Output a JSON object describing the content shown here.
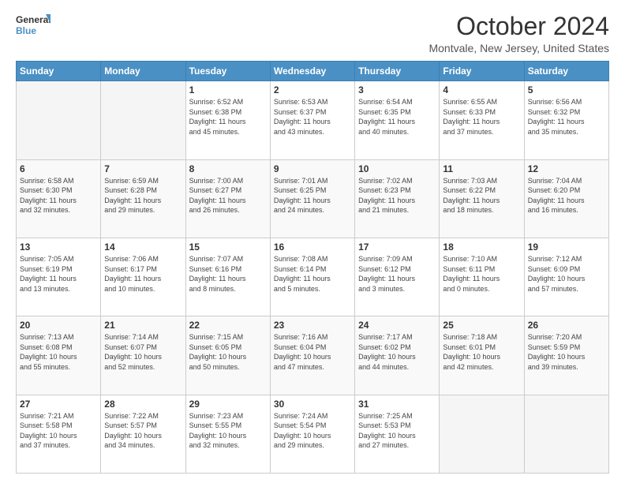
{
  "logo": {
    "line1": "General",
    "line2": "Blue",
    "icon_color": "#4a90c4"
  },
  "header": {
    "title": "October 2024",
    "subtitle": "Montvale, New Jersey, United States"
  },
  "days_of_week": [
    "Sunday",
    "Monday",
    "Tuesday",
    "Wednesday",
    "Thursday",
    "Friday",
    "Saturday"
  ],
  "weeks": [
    [
      {
        "day": "",
        "info": ""
      },
      {
        "day": "",
        "info": ""
      },
      {
        "day": "1",
        "info": "Sunrise: 6:52 AM\nSunset: 6:38 PM\nDaylight: 11 hours\nand 45 minutes."
      },
      {
        "day": "2",
        "info": "Sunrise: 6:53 AM\nSunset: 6:37 PM\nDaylight: 11 hours\nand 43 minutes."
      },
      {
        "day": "3",
        "info": "Sunrise: 6:54 AM\nSunset: 6:35 PM\nDaylight: 11 hours\nand 40 minutes."
      },
      {
        "day": "4",
        "info": "Sunrise: 6:55 AM\nSunset: 6:33 PM\nDaylight: 11 hours\nand 37 minutes."
      },
      {
        "day": "5",
        "info": "Sunrise: 6:56 AM\nSunset: 6:32 PM\nDaylight: 11 hours\nand 35 minutes."
      }
    ],
    [
      {
        "day": "6",
        "info": "Sunrise: 6:58 AM\nSunset: 6:30 PM\nDaylight: 11 hours\nand 32 minutes."
      },
      {
        "day": "7",
        "info": "Sunrise: 6:59 AM\nSunset: 6:28 PM\nDaylight: 11 hours\nand 29 minutes."
      },
      {
        "day": "8",
        "info": "Sunrise: 7:00 AM\nSunset: 6:27 PM\nDaylight: 11 hours\nand 26 minutes."
      },
      {
        "day": "9",
        "info": "Sunrise: 7:01 AM\nSunset: 6:25 PM\nDaylight: 11 hours\nand 24 minutes."
      },
      {
        "day": "10",
        "info": "Sunrise: 7:02 AM\nSunset: 6:23 PM\nDaylight: 11 hours\nand 21 minutes."
      },
      {
        "day": "11",
        "info": "Sunrise: 7:03 AM\nSunset: 6:22 PM\nDaylight: 11 hours\nand 18 minutes."
      },
      {
        "day": "12",
        "info": "Sunrise: 7:04 AM\nSunset: 6:20 PM\nDaylight: 11 hours\nand 16 minutes."
      }
    ],
    [
      {
        "day": "13",
        "info": "Sunrise: 7:05 AM\nSunset: 6:19 PM\nDaylight: 11 hours\nand 13 minutes."
      },
      {
        "day": "14",
        "info": "Sunrise: 7:06 AM\nSunset: 6:17 PM\nDaylight: 11 hours\nand 10 minutes."
      },
      {
        "day": "15",
        "info": "Sunrise: 7:07 AM\nSunset: 6:16 PM\nDaylight: 11 hours\nand 8 minutes."
      },
      {
        "day": "16",
        "info": "Sunrise: 7:08 AM\nSunset: 6:14 PM\nDaylight: 11 hours\nand 5 minutes."
      },
      {
        "day": "17",
        "info": "Sunrise: 7:09 AM\nSunset: 6:12 PM\nDaylight: 11 hours\nand 3 minutes."
      },
      {
        "day": "18",
        "info": "Sunrise: 7:10 AM\nSunset: 6:11 PM\nDaylight: 11 hours\nand 0 minutes."
      },
      {
        "day": "19",
        "info": "Sunrise: 7:12 AM\nSunset: 6:09 PM\nDaylight: 10 hours\nand 57 minutes."
      }
    ],
    [
      {
        "day": "20",
        "info": "Sunrise: 7:13 AM\nSunset: 6:08 PM\nDaylight: 10 hours\nand 55 minutes."
      },
      {
        "day": "21",
        "info": "Sunrise: 7:14 AM\nSunset: 6:07 PM\nDaylight: 10 hours\nand 52 minutes."
      },
      {
        "day": "22",
        "info": "Sunrise: 7:15 AM\nSunset: 6:05 PM\nDaylight: 10 hours\nand 50 minutes."
      },
      {
        "day": "23",
        "info": "Sunrise: 7:16 AM\nSunset: 6:04 PM\nDaylight: 10 hours\nand 47 minutes."
      },
      {
        "day": "24",
        "info": "Sunrise: 7:17 AM\nSunset: 6:02 PM\nDaylight: 10 hours\nand 44 minutes."
      },
      {
        "day": "25",
        "info": "Sunrise: 7:18 AM\nSunset: 6:01 PM\nDaylight: 10 hours\nand 42 minutes."
      },
      {
        "day": "26",
        "info": "Sunrise: 7:20 AM\nSunset: 5:59 PM\nDaylight: 10 hours\nand 39 minutes."
      }
    ],
    [
      {
        "day": "27",
        "info": "Sunrise: 7:21 AM\nSunset: 5:58 PM\nDaylight: 10 hours\nand 37 minutes."
      },
      {
        "day": "28",
        "info": "Sunrise: 7:22 AM\nSunset: 5:57 PM\nDaylight: 10 hours\nand 34 minutes."
      },
      {
        "day": "29",
        "info": "Sunrise: 7:23 AM\nSunset: 5:55 PM\nDaylight: 10 hours\nand 32 minutes."
      },
      {
        "day": "30",
        "info": "Sunrise: 7:24 AM\nSunset: 5:54 PM\nDaylight: 10 hours\nand 29 minutes."
      },
      {
        "day": "31",
        "info": "Sunrise: 7:25 AM\nSunset: 5:53 PM\nDaylight: 10 hours\nand 27 minutes."
      },
      {
        "day": "",
        "info": ""
      },
      {
        "day": "",
        "info": ""
      }
    ]
  ]
}
